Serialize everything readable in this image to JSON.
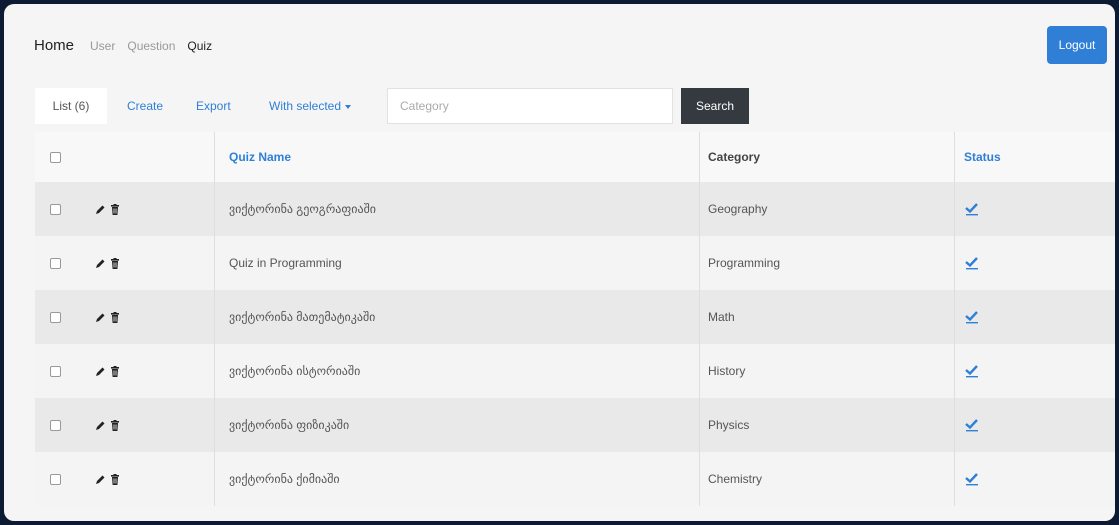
{
  "nav": {
    "brand": "Home",
    "links": [
      "User",
      "Question",
      "Quiz"
    ],
    "logout_label": "Logout"
  },
  "toolbar": {
    "list_tab": "List (6)",
    "create": "Create",
    "export": "Export",
    "with_selected": "With selected",
    "search_placeholder": "Category",
    "search_value": "",
    "search_button": "Search"
  },
  "table": {
    "columns": {
      "name": "Quiz Name",
      "category": "Category",
      "status": "Status"
    },
    "rows": [
      {
        "name": "ვიქტორინა გეოგრაფიაში",
        "category": "Geography"
      },
      {
        "name": "Quiz in Programming",
        "category": "Programming"
      },
      {
        "name": "ვიქტორინა მათემატიკაში",
        "category": "Math"
      },
      {
        "name": "ვიქტორინა ისტორიაში",
        "category": "History"
      },
      {
        "name": "ვიქტორინა ფიზიკაში",
        "category": "Physics"
      },
      {
        "name": "ვიქტორინა ქიმიაში",
        "category": "Chemistry"
      }
    ]
  },
  "icons": {
    "edit": "pencil-icon",
    "delete": "trash-icon",
    "status": "checkmark-icon"
  },
  "colors": {
    "accent": "#2f7fd6",
    "dark_button": "#343a40"
  }
}
